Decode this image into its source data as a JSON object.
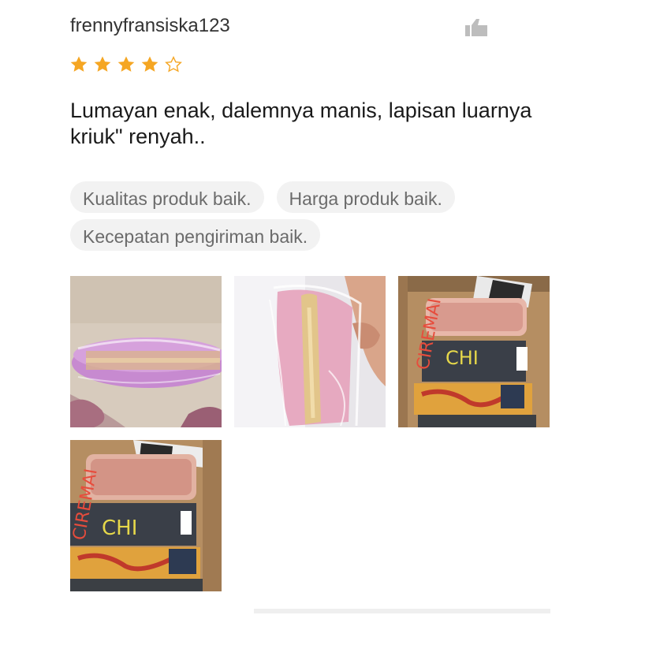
{
  "review": {
    "username": "frennyfransiska123",
    "rating": 4,
    "max_rating": 5,
    "text": "Lumayan enak, dalemnya manis, lapisan luarnya kriuk\" renyah..",
    "tags": [
      "Kualitas produk baik.",
      "Harga produk baik.",
      "Kecepatan pengiriman baik."
    ],
    "photos": [
      {
        "icon": "pink-wafer-photo"
      },
      {
        "icon": "wafer-in-plastic-photo"
      },
      {
        "icon": "snack-packages-photo"
      },
      {
        "icon": "snack-packages-photo"
      }
    ]
  },
  "colors": {
    "star_filled": "#f5a623",
    "star_empty_stroke": "#f5a623",
    "tag_bg": "#f2f2f2",
    "tag_text": "#6b6b6b"
  }
}
